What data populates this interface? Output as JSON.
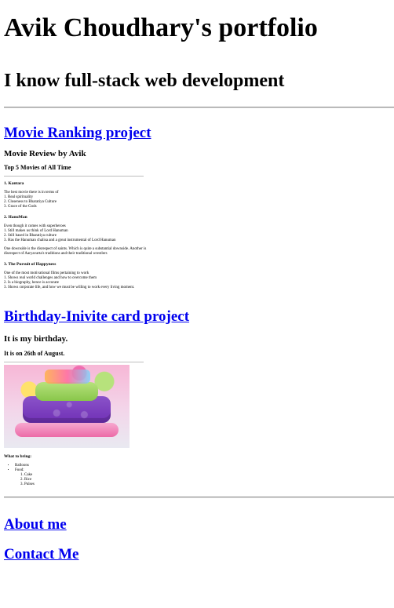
{
  "header": {
    "title": "Avik Choudhary's portfolio",
    "subtitle": "I know full-stack web development"
  },
  "projects": [
    {
      "link_label": "Movie Ranking project",
      "thumbnail": {
        "h1": "Movie Review by Avik",
        "h2": "Top 5 Movies of All Time",
        "items": [
          {
            "title": "1. Kantara",
            "lines": [
              "The best movie there is in terms of",
              "1. Real spirituality",
              "2. Closeness to Bharatiya Culture",
              "3. Grace of the Gods"
            ]
          },
          {
            "title": "2. HanuMan",
            "lines": [
              "Even though it comes with superheroes",
              "1. Still makes us think of Lord Hanuman",
              "2. Still based in Bharatiya culture",
              "3. Has the Hanuman chalisa and a great instrumental of Lord Hanuman"
            ],
            "note": "One downside is the disrespect of saints. Which is quite a substantial downside. Another is disrespect of Aaryavarta's traditions and their traditional wrestlers"
          },
          {
            "title": "3. The Pursuit of Happyness",
            "lines": [
              "One of the most motivational films pertaining to work",
              "1. Shows real world challenges and how to overcome them",
              "2. Is a biography, hence is accurate",
              "3. Shows corporate life, and how we must be willing to work every living moment."
            ]
          }
        ]
      }
    },
    {
      "link_label": "Birthday-Inivite card project",
      "thumbnail": {
        "h1": "It is my birthday.",
        "h2": "It is on 26th of August.",
        "image_alt": "birthday-cake-image",
        "bring_label": "What to bring:",
        "bring_items": [
          "Balloons",
          "Food:"
        ],
        "food_items": [
          "Cake",
          "Rice",
          "Pulses"
        ]
      }
    }
  ],
  "footer_links": {
    "about": "About me",
    "contact": "Contact Me"
  },
  "colors": {
    "link": "#0000ee",
    "text": "#000000",
    "rule": "#8a8a8a"
  }
}
